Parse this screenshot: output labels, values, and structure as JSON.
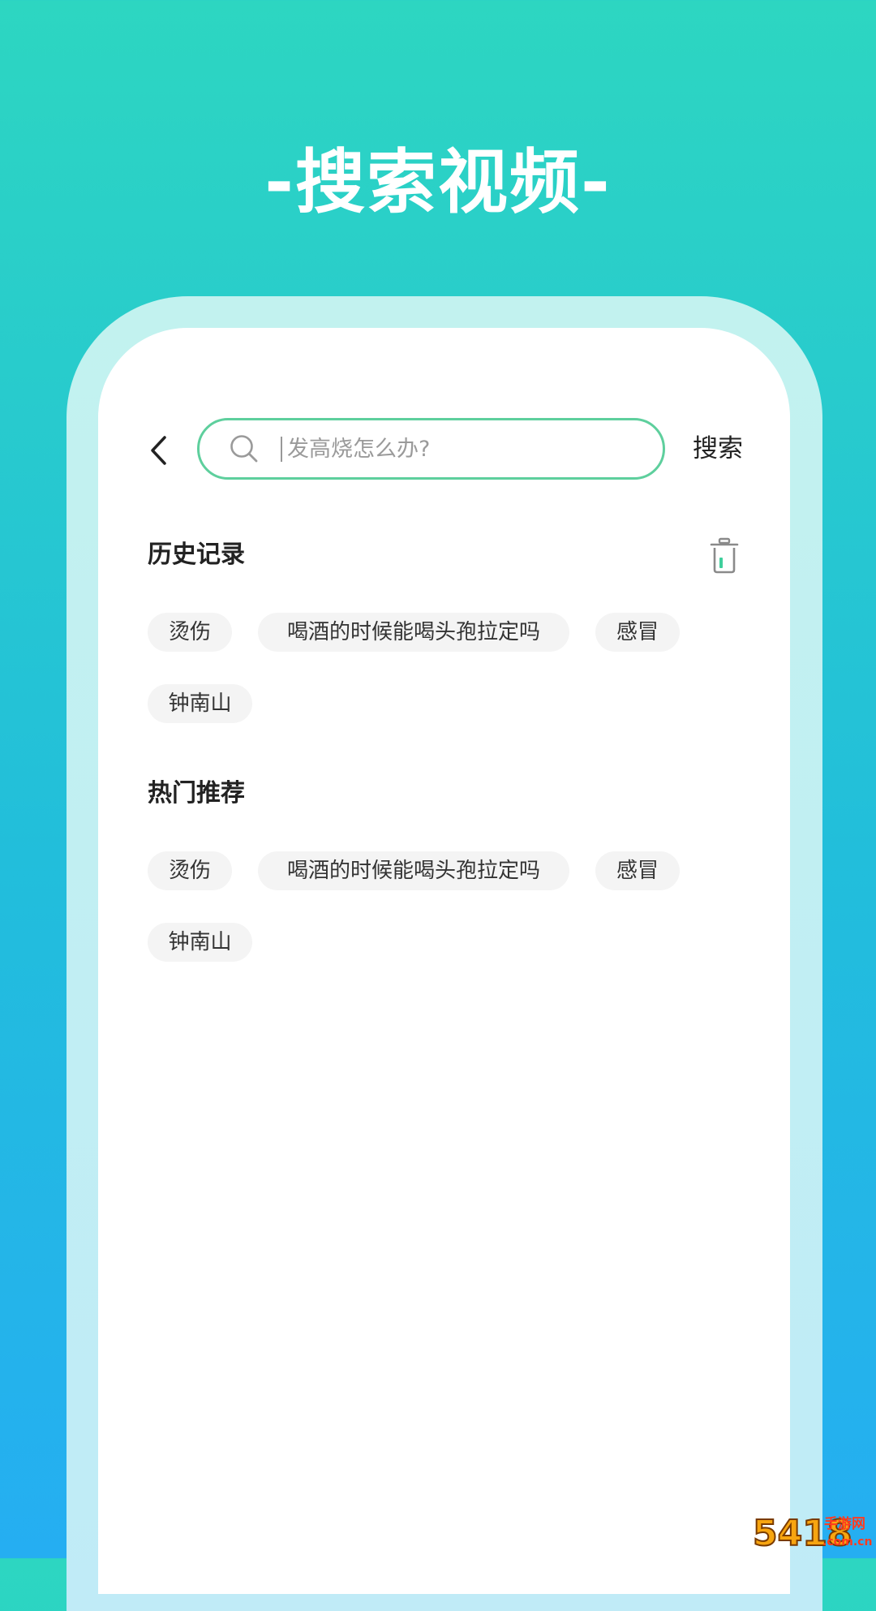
{
  "promo_title": "-搜索视频-",
  "search_bar": {
    "placeholder": "发高烧怎么办?",
    "search_label": "搜索"
  },
  "history": {
    "title": "历史记录",
    "chips": [
      "烫伤",
      "喝酒的时候能喝头孢拉定吗",
      "感冒",
      "钟南山"
    ]
  },
  "hot": {
    "title": "热门推荐",
    "chips": [
      "烫伤",
      "喝酒的时候能喝头孢拉定吗",
      "感冒",
      "钟南山"
    ]
  },
  "watermark": {
    "number": "5418",
    "label": "手游网",
    "sub": ".com.cn"
  },
  "colors": {
    "accent": "#5ecf9d",
    "background_top": "#2dd6c1",
    "background_bottom": "#25aef2",
    "chip_bg": "#f4f4f4"
  },
  "icons": {
    "back": "chevron-left-icon",
    "search": "search-icon",
    "trash": "trash-icon"
  }
}
